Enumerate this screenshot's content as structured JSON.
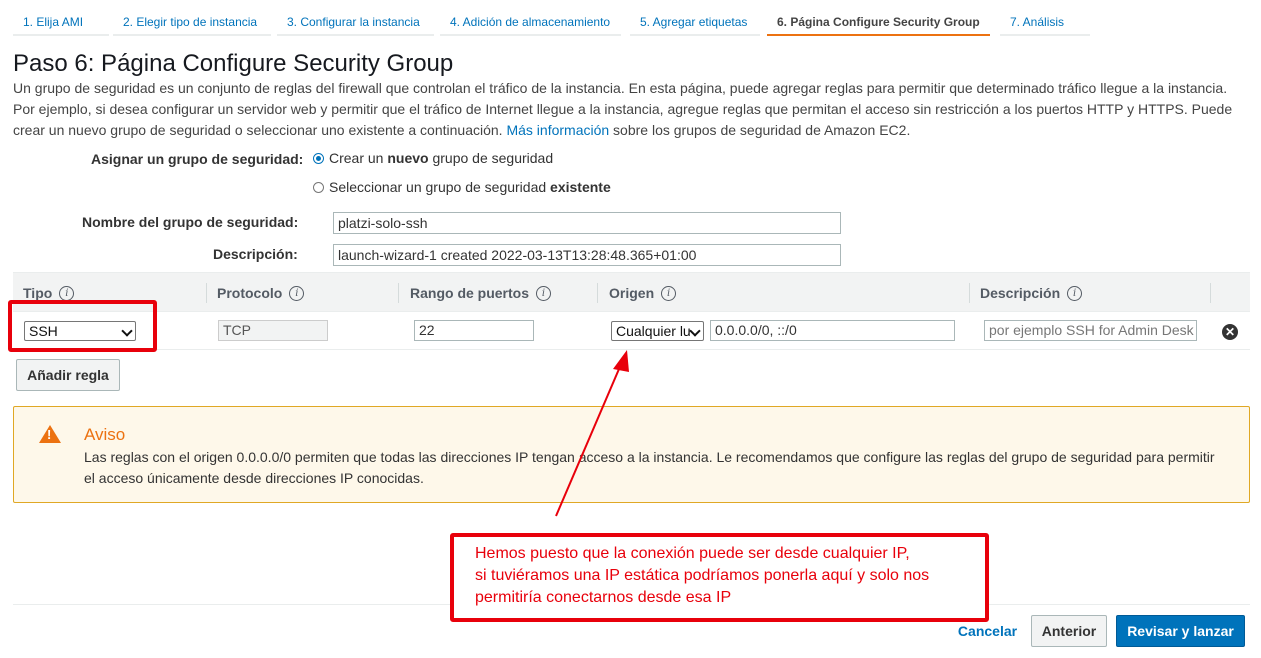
{
  "tabs": [
    {
      "label": "1. Elija AMI"
    },
    {
      "label": "2. Elegir tipo de instancia"
    },
    {
      "label": "3. Configurar la instancia"
    },
    {
      "label": "4. Adición de almacenamiento"
    },
    {
      "label": "5. Agregar etiquetas"
    },
    {
      "label": "6. Página Configure Security Group"
    },
    {
      "label": "7. Análisis"
    }
  ],
  "page": {
    "title": "Paso 6: Página Configure Security Group",
    "intro": "Un grupo de seguridad es un conjunto de reglas del firewall que controlan el tráfico de la instancia. En esta página, puede agregar reglas para permitir que determinado tráfico llegue a la instancia. Por ejemplo, si desea configurar un servidor web y permitir que el tráfico de Internet llegue a la instancia, agregue reglas que permitan el acceso sin restricción a los puertos HTTP y HTTPS. Puede crear un nuevo grupo de seguridad o seleccionar uno existente a continuación.",
    "learn_more": "Más información",
    "intro_tail": "sobre los grupos de seguridad de Amazon EC2."
  },
  "form": {
    "assign_label": "Asignar un grupo de seguridad:",
    "option_new": {
      "pre": "Crear un",
      "bold": "nuevo",
      "post": "grupo de seguridad",
      "selected": true
    },
    "option_existing": {
      "pre": "Seleccionar un grupo de seguridad",
      "bold": "existente",
      "selected": false
    },
    "name_label": "Nombre del grupo de seguridad:",
    "name_value": "platzi-solo-ssh",
    "desc_label": "Descripción:",
    "desc_value": "launch-wizard-1 created 2022-03-13T13:28:48.365+01:00"
  },
  "table": {
    "headers": [
      "Tipo",
      "Protocolo",
      "Rango de puertos",
      "Origen",
      "Descripción"
    ],
    "rows": [
      {
        "type": "SSH",
        "protocol": "TCP",
        "port_range": "22",
        "source_select": "Cualquier lu",
        "source_value": "0.0.0.0/0, ::/0",
        "description_placeholder": "por ejemplo SSH for Admin Desk"
      }
    ],
    "add_rule": "Añadir regla"
  },
  "warning": {
    "title": "Aviso",
    "text": "Las reglas con el origen 0.0.0.0/0 permiten que todas las direcciones IP tengan acceso a la instancia. Le recomendamos que configure las reglas del grupo de seguridad para permitir el acceso únicamente desde direcciones IP conocidas."
  },
  "annotation": {
    "lines": [
      "Hemos puesto que la conexión puede ser desde cualquier IP,",
      "si tuviéramos una IP estática podríamos ponerla aquí y solo nos",
      "permitiría conectarnos desde esa IP"
    ],
    "color": "#e8000b"
  },
  "footer": {
    "cancel": "Cancelar",
    "previous": "Anterior",
    "review": "Revisar y lanzar"
  },
  "colors": {
    "accent": "#0073bb",
    "active_tab": "#ec7211",
    "warning": "#ec7211"
  }
}
